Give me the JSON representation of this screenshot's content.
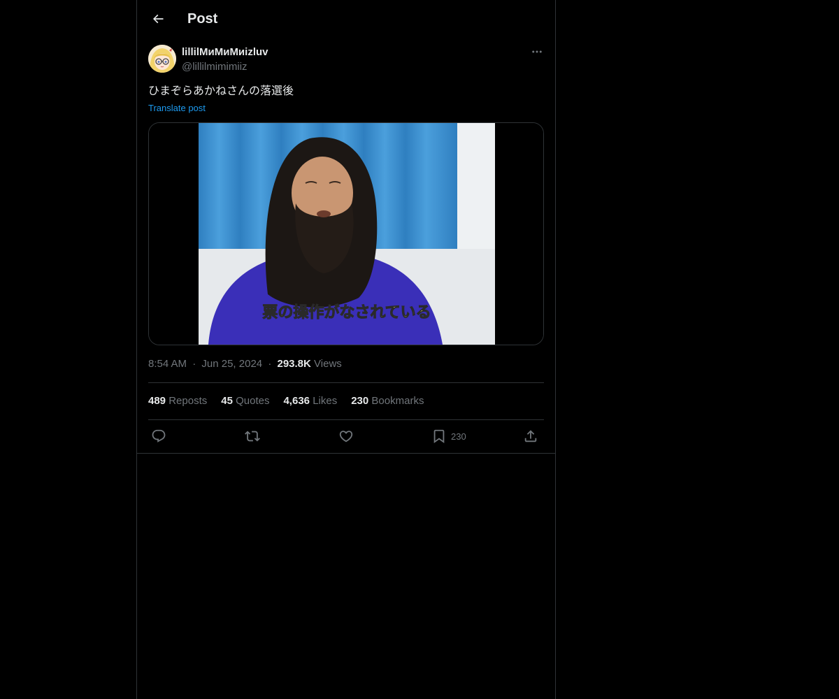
{
  "header": {
    "title": "Post",
    "back_icon": "arrow-left-icon"
  },
  "author": {
    "display_name": "lillilMиMиMиizluv",
    "handle": "@lillilmimimiiz",
    "avatar_icon": "avatar-anime-girl-glasses"
  },
  "post": {
    "text": "ひまぞらあかねさんの落選後",
    "translate_label": "Translate post",
    "media": {
      "caption": "票の操作がなされている",
      "icon": "video-thumbnail"
    }
  },
  "meta": {
    "time": "8:54 AM",
    "separator": "·",
    "date": "Jun 25, 2024",
    "views_count": "293.8K",
    "views_label": "Views"
  },
  "stats": {
    "reposts_count": "489",
    "reposts_label": "Reposts",
    "quotes_count": "45",
    "quotes_label": "Quotes",
    "likes_count": "4,636",
    "likes_label": "Likes",
    "bookmarks_count": "230",
    "bookmarks_label": "Bookmarks"
  },
  "actions": {
    "reply_icon": "reply-icon",
    "repost_icon": "repost-icon",
    "like_icon": "heart-icon",
    "bookmark_icon": "bookmark-icon",
    "bookmark_count": "230",
    "share_icon": "share-icon"
  },
  "colors": {
    "background": "#000000",
    "text": "#e7e9ea",
    "muted": "#71767b",
    "link": "#1d9bf0",
    "border": "#2f3336"
  }
}
